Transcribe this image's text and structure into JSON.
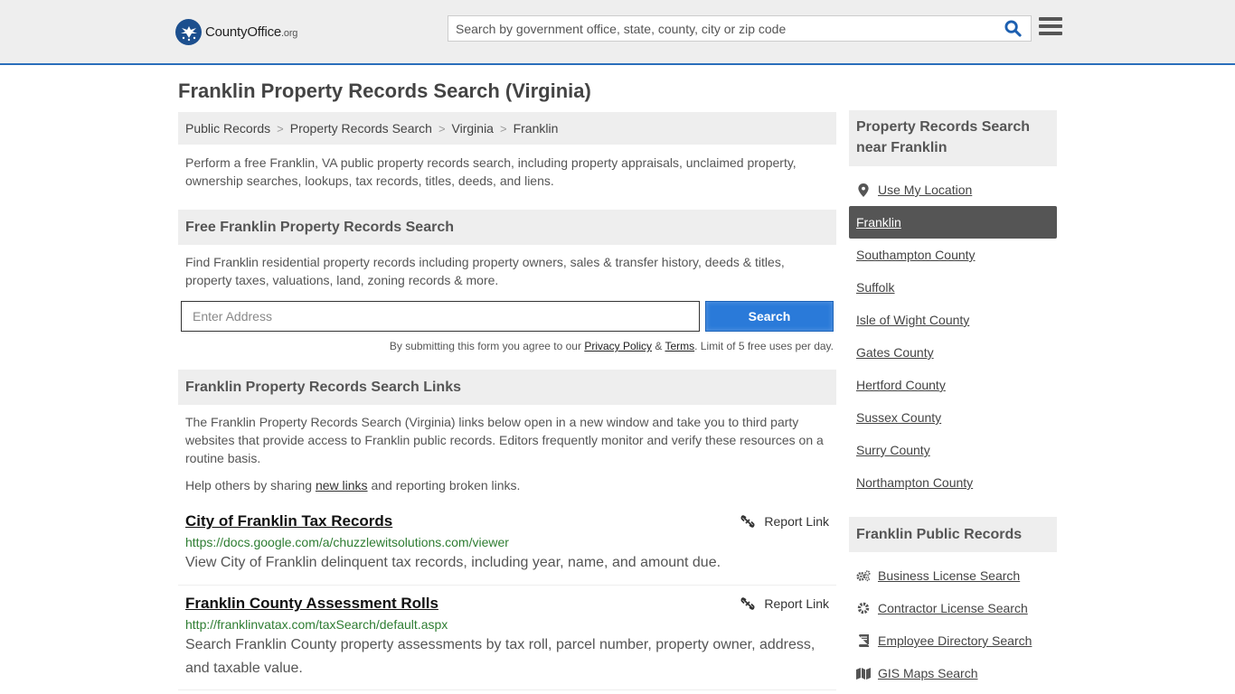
{
  "header": {
    "logo_text_main": "CountyOffice",
    "logo_text_suffix": ".org",
    "search_placeholder": "Search by government office, state, county, city or zip code"
  },
  "page_title": "Franklin Property Records Search (Virginia)",
  "breadcrumb": [
    "Public Records",
    "Property Records Search",
    "Virginia",
    "Franklin"
  ],
  "intro": "Perform a free Franklin, VA public property records search, including property appraisals, unclaimed property, ownership searches, lookups, tax records, titles, deeds, and liens.",
  "free_search": {
    "heading": "Free Franklin Property Records Search",
    "description": "Find Franklin residential property records including property owners, sales & transfer history, deeds & titles, property taxes, valuations, land, zoning records & more.",
    "address_placeholder": "Enter Address",
    "button_label": "Search",
    "disclaimer_prefix": "By submitting this form you agree to our ",
    "privacy_label": "Privacy Policy",
    "amp": " & ",
    "terms_label": "Terms",
    "disclaimer_suffix": ". Limit of 5 free uses per day."
  },
  "links_section": {
    "heading": "Franklin Property Records Search Links",
    "description": "The Franklin Property Records Search (Virginia) links below open in a new window and take you to third party websites that provide access to Franklin public records. Editors frequently monitor and verify these resources on a routine basis.",
    "help_prefix": "Help others by sharing ",
    "help_link": "new links",
    "help_suffix": " and reporting broken links.",
    "report_label": "Report Link",
    "items": [
      {
        "title": "City of Franklin Tax Records",
        "url": "https://docs.google.com/a/chuzzlewitsolutions.com/viewer",
        "description": "View City of Franklin delinquent tax records, including year, name, and amount due."
      },
      {
        "title": "Franklin County Assessment Rolls",
        "url": "http://franklinvatax.com/taxSearch/default.aspx",
        "description": "Search Franklin County property assessments by tax roll, parcel number, property owner, address, and taxable value."
      }
    ]
  },
  "sidebar": {
    "nearby_heading": "Property Records Search near Franklin",
    "use_location": "Use My Location",
    "nearby": [
      {
        "label": "Franklin",
        "active": true
      },
      {
        "label": "Southampton County",
        "active": false
      },
      {
        "label": "Suffolk",
        "active": false
      },
      {
        "label": "Isle of Wight County",
        "active": false
      },
      {
        "label": "Gates County",
        "active": false
      },
      {
        "label": "Hertford County",
        "active": false
      },
      {
        "label": "Sussex County",
        "active": false
      },
      {
        "label": "Surry County",
        "active": false
      },
      {
        "label": "Northampton County",
        "active": false
      }
    ],
    "public_heading": "Franklin Public Records",
    "public": [
      {
        "label": "Business License Search",
        "icon": "gears-icon"
      },
      {
        "label": "Contractor License Search",
        "icon": "gear-icon"
      },
      {
        "label": "Employee Directory Search",
        "icon": "book-icon"
      },
      {
        "label": "GIS Maps Search",
        "icon": "map-icon"
      }
    ]
  }
}
